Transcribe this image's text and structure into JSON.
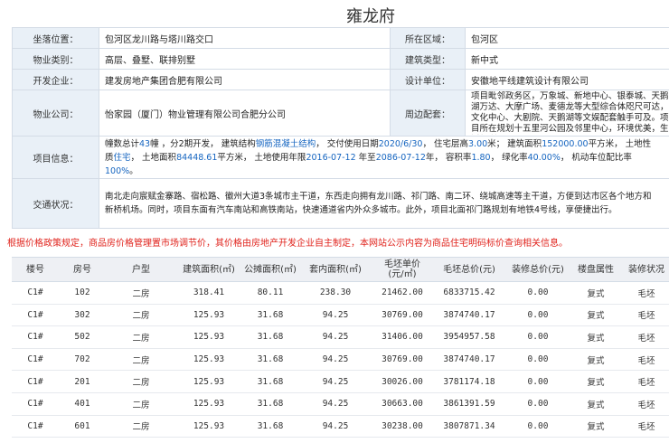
{
  "title": "雍龙府",
  "info": {
    "location_label": "坐落位置：",
    "location": "包河区龙川路与塔川路交口",
    "district_label": "所在区域：",
    "district": "包河区",
    "property_type_label": "物业类别：",
    "property_type": "高层、叠墅、联排别墅",
    "building_type_label": "建筑类型：",
    "building_type": "新中式",
    "developer_label": "开发企业：",
    "developer": "建发房地产集团合肥有限公司",
    "design_label": "设计单位：",
    "design": "安徽地平线建筑设计有限公司",
    "property_co_label": "物业公司：",
    "property_co": "怡家园（厦门）物业管理有限公司合肥分公司",
    "facilities_label": "周边配套：",
    "facilities": "项目毗邻政务区，万象城、新地中心、银泰城、天鹅湖万达、大摩广场、麦德龙等大型综合体咫尺可达，文化中心、大剧院、天鹅湖等文娱配套触手可及。项目所在规划十五里河公园及邻里中心，环境优美，生活便利。",
    "project_label": "项目信息：",
    "project": {
      "t1": "幢数总计",
      "buildings": "43",
      "t2": "幢 ，分2期开发， 建筑结构",
      "structure": "钢筋混凝土结构",
      "t3": "， 交付使用日期",
      "delivery": "2020/6/30",
      "t4": "， 住宅层高",
      "floor_height": "3.00",
      "t5": "米； 建筑面积",
      "building_area": "152000.00",
      "t6": "平方米， 土地性质",
      "land_use": "住宅",
      "t7": "， 土地面积",
      "land_area": "84448.61",
      "t8": "平方米， 土地使用年限",
      "land_start": "2016-07-12",
      "t9": " 年至",
      "land_end": "2086-07-12",
      "t10": "年， 容积率",
      "far": "1.80",
      "t11": "， 绿化率",
      "green": "40.00%",
      "t12": "， 机动车位配比率",
      "parking": "100%",
      "t13": "。"
    },
    "traffic_label": "交通状况：",
    "traffic": "南北走向宸赋金寨路、宿松路、徽州大道3条城市主干道，东西走向拥有龙川路、祁门路、南二环、绕城高速等主干道，方便到达市区各个地方和新桥机场。同时，项目东面有汽车南站和高铁南站，快速通道省内外众多城市。此外，项目北面祁门路规划有地铁4号线，享便捷出行。"
  },
  "notice": "根据价格政策规定，商品房价格管理置市场调节价，其价格由房地产开发企业自主制定，本网站公示内容为商品住宅明码标价查询相关信息。",
  "units_header": [
    "楼号",
    "房号",
    "户型",
    "建筑面积(㎡)",
    "公摊面积(㎡)",
    "套内面积(㎡)",
    "毛坯单价\n(元/㎡)",
    "毛坯总价(元)",
    "装修总价(元)",
    "楼盘属性",
    "装修状况"
  ],
  "units": [
    [
      "C1#",
      "102",
      "二房",
      "318.41",
      "80.11",
      "238.30",
      "21462.00",
      "6833715.42",
      "0.00",
      "复式",
      "毛坯"
    ],
    [
      "C1#",
      "302",
      "二房",
      "125.93",
      "31.68",
      "94.25",
      "30769.00",
      "3874740.17",
      "0.00",
      "复式",
      "毛坯"
    ],
    [
      "C1#",
      "502",
      "二房",
      "125.93",
      "31.68",
      "94.25",
      "31406.00",
      "3954957.58",
      "0.00",
      "复式",
      "毛坯"
    ],
    [
      "C1#",
      "702",
      "二房",
      "125.93",
      "31.68",
      "94.25",
      "30769.00",
      "3874740.17",
      "0.00",
      "复式",
      "毛坯"
    ],
    [
      "C1#",
      "201",
      "二房",
      "125.93",
      "31.68",
      "94.25",
      "30026.00",
      "3781174.18",
      "0.00",
      "复式",
      "毛坯"
    ],
    [
      "C1#",
      "401",
      "二房",
      "125.93",
      "31.68",
      "94.25",
      "30663.00",
      "3861391.59",
      "0.00",
      "复式",
      "毛坯"
    ],
    [
      "C1#",
      "601",
      "二房",
      "125.93",
      "31.68",
      "94.25",
      "30238.00",
      "3807871.34",
      "0.00",
      "复式",
      "毛坯"
    ]
  ]
}
